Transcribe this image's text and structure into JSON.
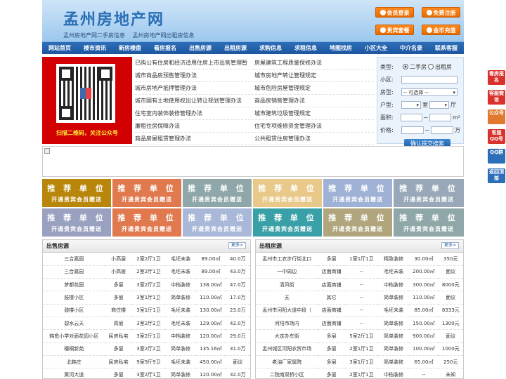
{
  "header": {
    "logo": "孟州房地产网",
    "subtitle1": "孟州房地产网二手房信息",
    "subtitle2": "孟州房地产网出租房信息",
    "buttons": [
      "会员登录",
      "免费注册",
      "贵宾套餐",
      "金币充值"
    ]
  },
  "nav": [
    "网站首页",
    "楼市资讯",
    "新房楼盘",
    "看房报名",
    "出售房源",
    "出租房源",
    "求购信息",
    "求租信息",
    "地图找房",
    "小区大全",
    "中介名录",
    "联系客服"
  ],
  "qr": {
    "caption": "扫描二维码，关注公众号"
  },
  "news": [
    [
      "已购公有住房和经济适用住房上市出售管理暂",
      "房屋建筑工程质量保修办法"
    ],
    [
      "城市商品房预售管理办法",
      "城市房地产转让管理规定"
    ],
    [
      "城市房地产抵押管理办法",
      "城市危险房屋管理规定"
    ],
    [
      "城市国有土地使用权出让转让规划管理办法",
      "商品房销售管理办法"
    ],
    [
      "住宅室内装饰装修管理办法",
      "城市建筑垃圾管理规定"
    ],
    [
      "廉租住房保障办法",
      "住宅专项维修资金管理办法"
    ],
    [
      "商品房屋租赁管理办法",
      "公共租赁住房管理办法"
    ]
  ],
  "search": {
    "type_label": "类型:",
    "opt1": "二手房",
    "opt2": "出租房",
    "area_label": "小区:",
    "house_label": "房型:",
    "house_value": "-- 可选择 --",
    "layout_label": "户型:",
    "room_unit": "室",
    "hall_unit": "厅",
    "size_label": "面积:",
    "size_unit": "m²",
    "price_label": "价格:",
    "price_unit": "万",
    "submit": "确认提交搜索"
  },
  "recommend": {
    "t1": "推 荐 单 位",
    "t2": "开通贵宾会员赠送",
    "colors": [
      "#b8860b",
      "#e07a4e",
      "#8fa7a8",
      "#e8c98a",
      "#9fb2d6",
      "#98a8b8",
      "#9aa0c0",
      "#e07a4e",
      "#a9b8d8",
      "#3aa0a8",
      "#b0a57c",
      "#8fa7a8"
    ]
  },
  "sale": {
    "title": "出售房源",
    "more": "更多>",
    "rows": [
      [
        "三合嘉园",
        "小高层",
        "2室2厅1卫",
        "毛坯未装",
        "89.00㎡",
        "40.0万"
      ],
      [
        "三合嘉园",
        "小高层",
        "2室2厅1卫",
        "毛坯未装",
        "89.00㎡",
        "43.0万"
      ],
      [
        "梦都花园",
        "多层",
        "3室2厅2卫",
        "中档装修",
        "138.00㎡",
        "47.0万"
      ],
      [
        "鼓楼小区",
        "多层",
        "3室1厅1卫",
        "简单装修",
        "110.00㎡",
        "17.0万"
      ],
      [
        "鼓楼小区",
        "商住楼",
        "3室1厅1卫",
        "毛坯未装",
        "130.00㎡",
        "23.0万"
      ],
      [
        "碧水云天",
        "高层",
        "3室2厅2卫",
        "毛坯未装",
        "129.00㎡",
        "42.0万"
      ],
      [
        "韩愈小学对面花园小区",
        "民房私宅",
        "3室2厅1卫",
        "中档装修",
        "120.00㎡",
        "29.0万"
      ],
      [
        "檀桐新苑",
        "多层",
        "3室2厅2卫",
        "简单装修",
        "135.16㎡",
        "31.0万"
      ],
      [
        "北韩庄",
        "民房私宅",
        "9室9厅9卫",
        "毛坯未装",
        "450.00㎡",
        "面议"
      ],
      [
        "黄河大道",
        "多层",
        "3室2厅1卫",
        "简单装修",
        "120.00㎡",
        "32.0万"
      ]
    ]
  },
  "rent": {
    "title": "出租房源",
    "more": "更多>",
    "rows": [
      [
        "孟州市工农步行街北口",
        "多层",
        "1室1厅1卫",
        "精致装修",
        "30.00㎡",
        "350元"
      ],
      [
        "一中周边",
        "店面商铺",
        "--",
        "毛坯未装",
        "200.00㎡",
        "面议"
      ],
      [
        "清风街",
        "店面商铺",
        "--",
        "中档装修",
        "300.00㎡",
        "8000元"
      ],
      [
        "无",
        "其它",
        "--",
        "简单装修",
        "110.00㎡",
        "面议"
      ],
      [
        "孟州市河阳大道中段（",
        "店面商铺",
        "--",
        "毛坯未装",
        "85.00㎡",
        "8333元"
      ],
      [
        "河阳市场内",
        "店面商铺",
        "--",
        "简单装修",
        "150.00㎡",
        "1300元"
      ],
      [
        "大定办东街",
        "多层",
        "5室2厅1卫",
        "简单装修",
        "900.00㎡",
        "面议"
      ],
      [
        "孟州城区河阳农贸市场",
        "多层",
        "2室1厅1卫",
        "简单装修",
        "100.00㎡",
        "1000元"
      ],
      [
        "老油厂家属院",
        "多层",
        "3室1厅1卫",
        "简单装修",
        "65.00㎡",
        "250元"
      ],
      [
        "二院南双桥小区",
        "多层",
        "2室1厅1卫",
        "中档装修",
        "--",
        "未知"
      ]
    ]
  },
  "sidebar": [
    "看房报名",
    "客服微信",
    "公众号",
    "客服QQ号",
    "QQ群",
    "返回顶部"
  ]
}
